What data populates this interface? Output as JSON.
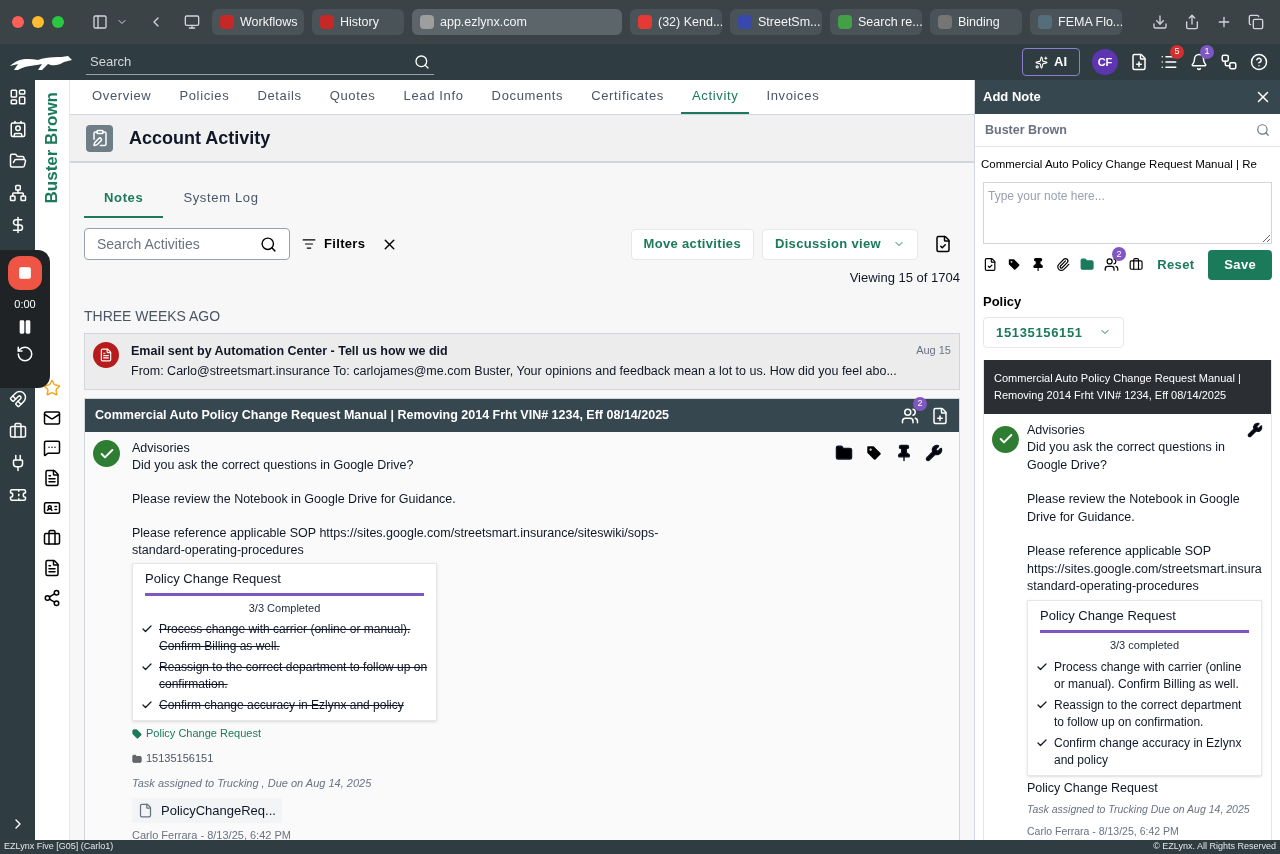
{
  "browser": {
    "tabs": [
      {
        "label": "Workflows",
        "selected": false,
        "color": "#c62828"
      },
      {
        "label": "History",
        "selected": false,
        "color": "#c62828"
      },
      {
        "label": "app.ezlynx.com",
        "selected": true,
        "color": "#9e9e9e"
      },
      {
        "label": "(32) Kend...",
        "selected": false,
        "color": "#e53935"
      },
      {
        "label": "StreetSm...",
        "selected": false,
        "color": "#3949ab"
      },
      {
        "label": "Search re...",
        "selected": false,
        "color": "#43a047"
      },
      {
        "label": "Binding",
        "selected": false,
        "color": "#757575"
      },
      {
        "label": "FEMA Flo...",
        "selected": false,
        "color": "#546e7a"
      }
    ]
  },
  "app_bar": {
    "search_placeholder": "Search",
    "ai_label": "AI",
    "avatar": "CF",
    "tasks_badge": "5",
    "alerts_badge": "1"
  },
  "recorder": {
    "time": "0:00"
  },
  "account_name": "Buster Brown",
  "nav_tabs": [
    {
      "label": "Overview",
      "selected": false
    },
    {
      "label": "Policies",
      "selected": false
    },
    {
      "label": "Details",
      "selected": false
    },
    {
      "label": "Quotes",
      "selected": false
    },
    {
      "label": "Lead Info",
      "selected": false
    },
    {
      "label": "Documents",
      "selected": false
    },
    {
      "label": "Certificates",
      "selected": false
    },
    {
      "label": "Activity",
      "selected": true
    },
    {
      "label": "Invoices",
      "selected": false
    }
  ],
  "page_title": "Account Activity",
  "sub_tabs": [
    {
      "label": "Notes",
      "selected": true
    },
    {
      "label": "System Log",
      "selected": false
    }
  ],
  "toolbar": {
    "search_placeholder": "Search Activities",
    "filters": "Filters",
    "move": "Move activities",
    "view": "Discussion view",
    "viewing": "Viewing 15 of 1704"
  },
  "group_label": "THREE WEEKS AGO",
  "email": {
    "title": "Email sent by Automation Center - Tell us how we did",
    "preview": "From: Carlo@streetsmart.insurance To: carlojames@me.com Buster, Your opinions and feedback mean a lot to us. How did you feel abo...",
    "date": "Aug 15"
  },
  "note": {
    "title": "Commercial Auto Policy Change Request Manual | Removing 2014 Frht VIN# 1234, Eff 08/14/2025",
    "people_badge": "2",
    "category": "Advisories",
    "paragraphs": [
      "Did you ask the correct questions in Google Drive?",
      "Please review the Notebook in Google Drive for Guidance.",
      "Please reference applicable SOP https://sites.google.com/streetsmart.insurance/siteswiki/sops-standard-operating-procedures"
    ],
    "checklist": {
      "title": "Policy Change Request",
      "progress": "3/3 Completed",
      "level": 1,
      "items": [
        {
          "text": "Process change with carrier (online or manual). Confirm Billing as well.",
          "checked": true
        },
        {
          "text": "Reassign to the correct department to follow up on confirmation.",
          "checked": true
        },
        {
          "text": "Confirm change accuracy in Ezlynx and policy",
          "checked": true
        }
      ]
    },
    "tag": "Policy Change Request",
    "policy": "15135156151",
    "task": "Task assigned to Trucking , Due on Aug 14, 2025",
    "attachment": "PolicyChangeReq...",
    "author": "Carlo Ferrara - 8/13/25, 6:42 PM"
  },
  "add_note": {
    "title": "Add Note",
    "client": "Buster Brown",
    "subject": "Commercial Auto Policy Change Request Manual | Re",
    "note_placeholder": "Type your note here...",
    "people_badge": "2",
    "reset": "Reset",
    "save": "Save",
    "policy_label": "Policy",
    "policy_value": "15135156151",
    "preview": {
      "title": "Commercial Auto Policy Change Request Manual | Removing 2014 Frht VIN# 1234, Eff 08/14/2025",
      "category": "Advisories",
      "paragraphs": [
        "Did you ask the correct questions in Google Drive?",
        "Please review the Notebook in Google Drive for Guidance.",
        "Please reference applicable SOP https://sites.google.com/streetsmart.insura standard-operating-procedures"
      ],
      "checklist": {
        "title": "Policy Change Request",
        "progress": "3/3 completed",
        "level": 1,
        "items": [
          {
            "text": "Process change with carrier (online or manual). Confirm Billing as well.",
            "checked": true
          },
          {
            "text": "Reassign to the correct department to follow up on confirmation.",
            "checked": true
          },
          {
            "text": "Confirm change accuracy in Ezlynx and policy",
            "checked": true
          }
        ]
      },
      "tag": "Policy Change Request",
      "task": "Task assigned to Trucking Due on Aug 14, 2025",
      "author": "Carlo Ferrara - 8/13/25, 6:42 PM"
    }
  },
  "status_bar": {
    "left": "EZLynx Five [G05] (Carlo1)",
    "right": "© EZLynx. All Rights Reserved"
  }
}
